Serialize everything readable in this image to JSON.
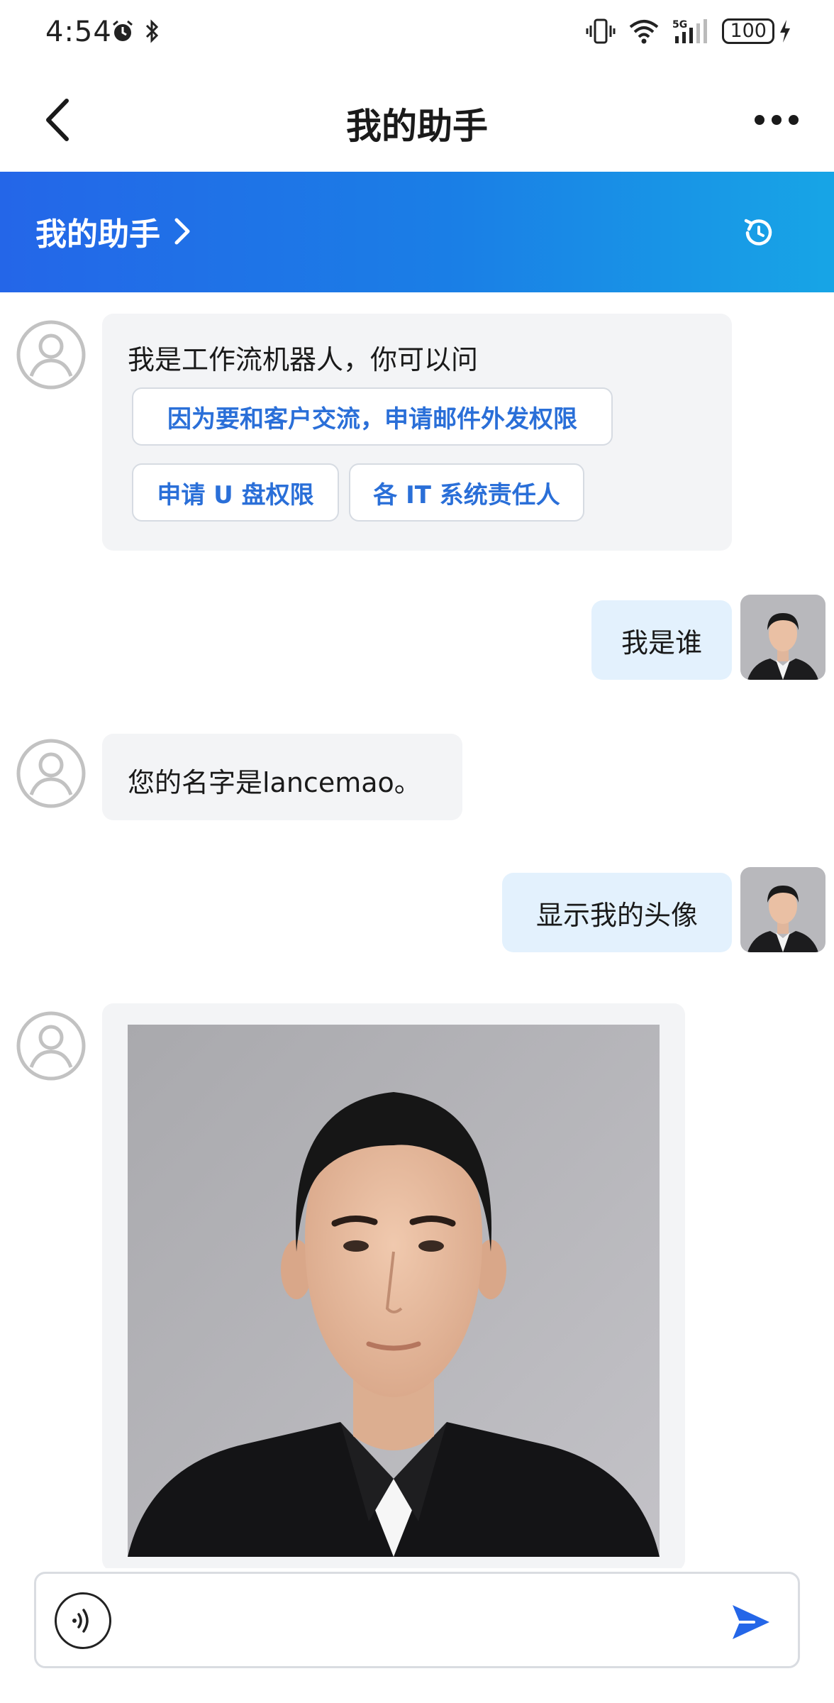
{
  "status_bar": {
    "time": "4:54",
    "battery": "100",
    "network": "5G"
  },
  "header": {
    "title": "我的助手"
  },
  "banner": {
    "title": "我的助手"
  },
  "messages": {
    "bot_greeting": "我是工作流机器人，你可以问",
    "suggestions": [
      "因为要和客户交流，申请邮件外发权限",
      "申请 U 盘权限",
      "各 IT 系统责任人"
    ],
    "user_1": "我是谁",
    "bot_1": "您的名字是lancemao。",
    "user_2": "显示我的头像"
  },
  "colors": {
    "accent": "#2a6fd8",
    "banner_start": "#2466e8",
    "banner_end": "#17a5e6",
    "user_bubble": "#e3f1fd",
    "bot_bubble": "#f3f4f6"
  },
  "icons": {
    "back": "chevron-left-icon",
    "more": "more-dots-icon",
    "refresh": "refresh-icon",
    "voice": "voice-icon",
    "send": "send-icon"
  }
}
